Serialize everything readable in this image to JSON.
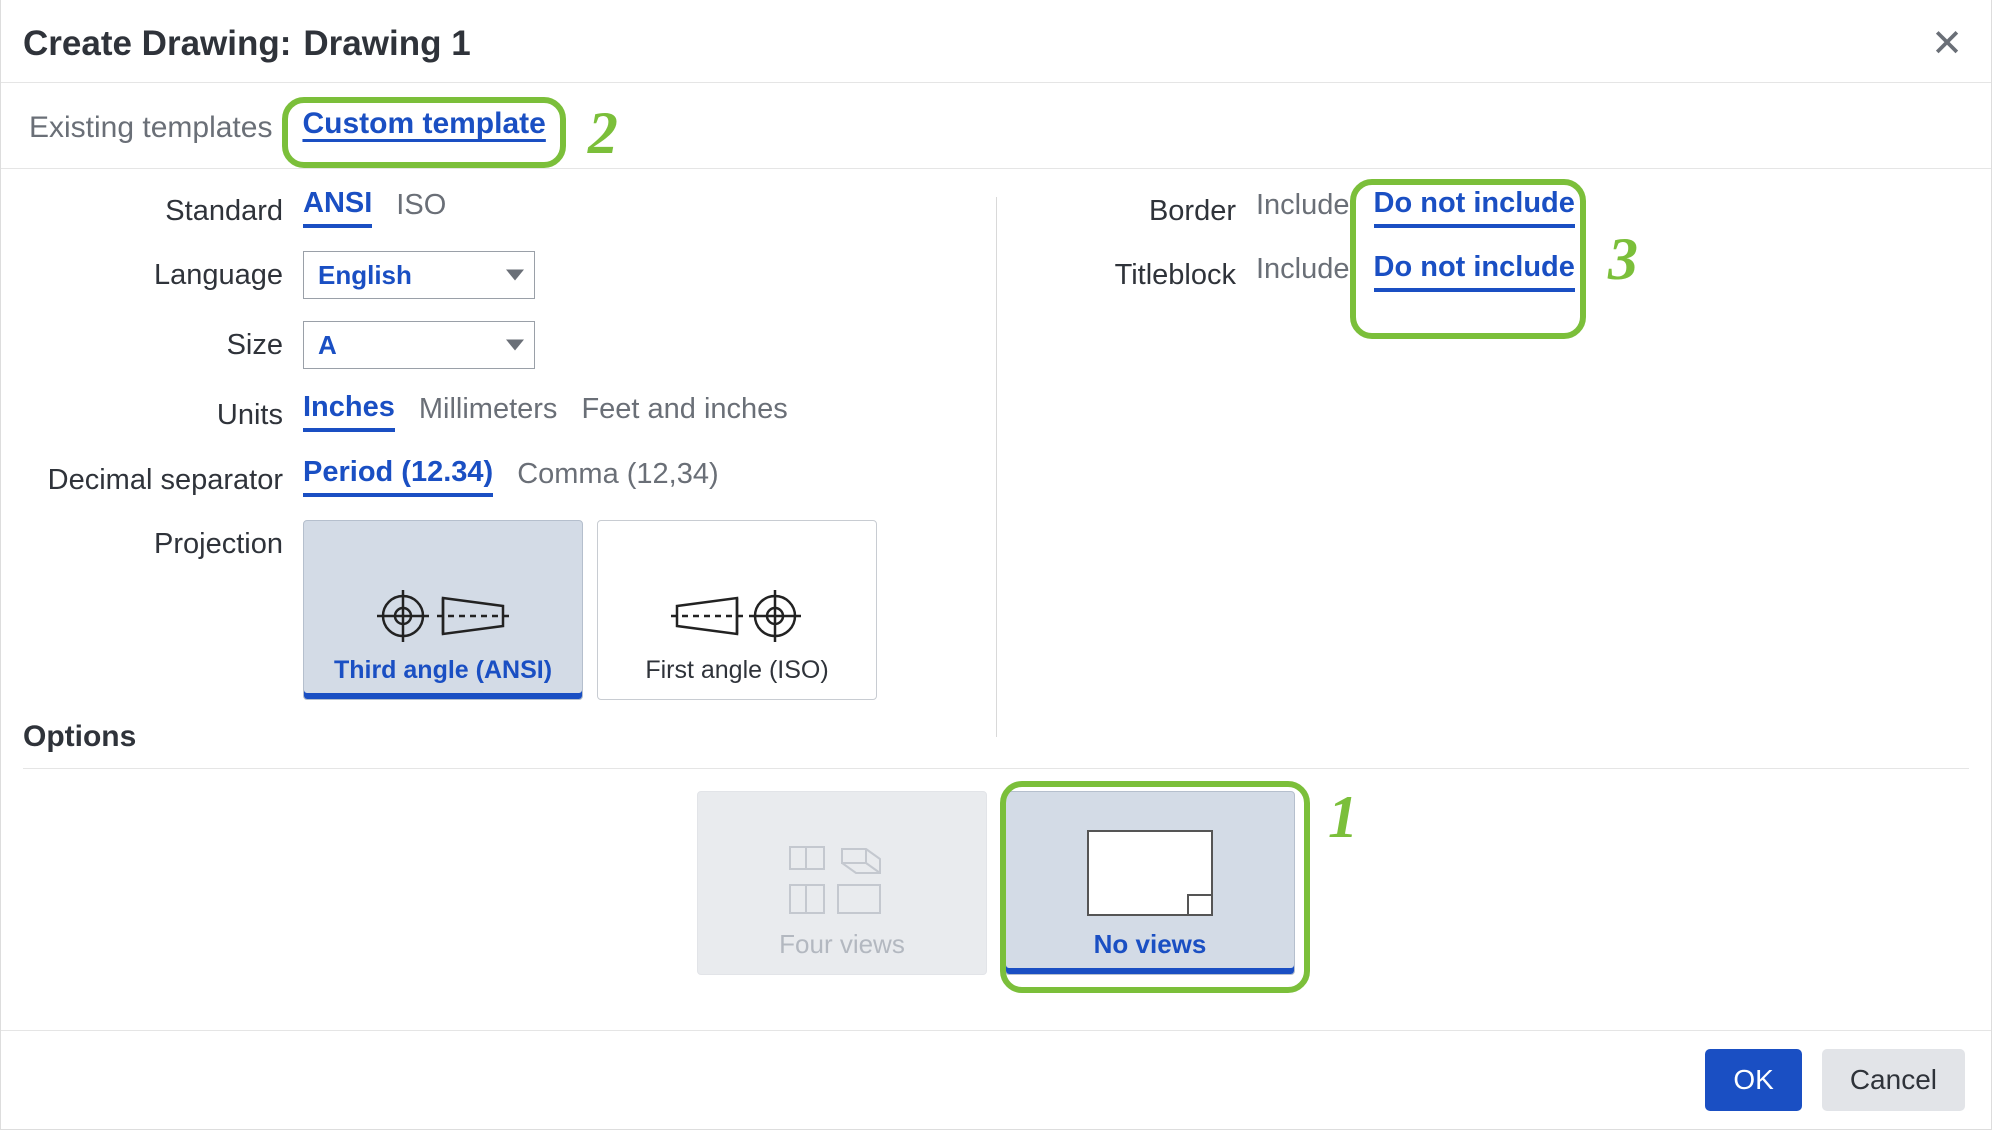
{
  "dialog": {
    "title_prefix": "Create Drawing:",
    "title_name": "Drawing 1"
  },
  "tabs": {
    "existing": "Existing templates",
    "custom": "Custom template"
  },
  "left": {
    "standard_label": "Standard",
    "standard_options": {
      "ansi": "ANSI",
      "iso": "ISO"
    },
    "language_label": "Language",
    "language_value": "English",
    "size_label": "Size",
    "size_value": "A",
    "units_label": "Units",
    "units_options": {
      "in": "Inches",
      "mm": "Millimeters",
      "ftin": "Feet and inches"
    },
    "decimal_label": "Decimal separator",
    "decimal_options": {
      "period": "Period (12.34)",
      "comma": "Comma (12,34)"
    },
    "projection_label": "Projection",
    "projection_options": {
      "third": "Third angle (ANSI)",
      "first": "First angle (ISO)"
    }
  },
  "right": {
    "border_label": "Border",
    "titleblock_label": "Titleblock",
    "include": "Include",
    "do_not_include": "Do not include"
  },
  "options": {
    "section": "Options",
    "four_views": "Four views",
    "no_views": "No views"
  },
  "footer": {
    "ok": "OK",
    "cancel": "Cancel"
  },
  "annotations": {
    "one": "1",
    "two": "2",
    "three": "3"
  }
}
